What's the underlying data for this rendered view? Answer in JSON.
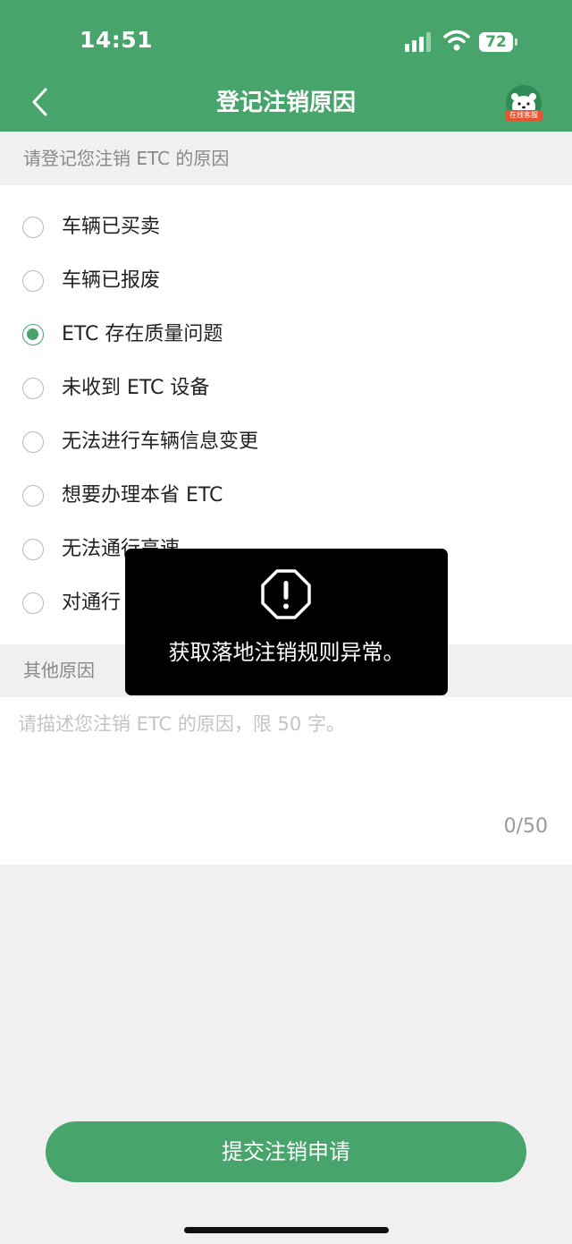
{
  "status_bar": {
    "time": "14:51",
    "battery": "72"
  },
  "nav": {
    "title": "登记注销原因",
    "service_badge": "在线客服"
  },
  "reasons_section": {
    "header": "请登记您注销 ETC 的原因"
  },
  "reasons": [
    {
      "label": "车辆已买卖",
      "selected": false
    },
    {
      "label": "车辆已报废",
      "selected": false
    },
    {
      "label": "ETC 存在质量问题",
      "selected": true
    },
    {
      "label": "未收到 ETC 设备",
      "selected": false
    },
    {
      "label": "无法进行车辆信息变更",
      "selected": false
    },
    {
      "label": "想要办理本省 ETC",
      "selected": false
    },
    {
      "label": "无法通行高速",
      "selected": false
    },
    {
      "label": "对通行",
      "selected": false
    }
  ],
  "other_section": {
    "header": "其他原因",
    "placeholder": "请描述您注销 ETC 的原因，限 50 字。",
    "counter": "0/50"
  },
  "toast": {
    "message": "获取落地注销规则异常。"
  },
  "submit_label": "提交注销申请",
  "colors": {
    "brand_green": "#47a56b",
    "toast_bg": "#000000"
  }
}
